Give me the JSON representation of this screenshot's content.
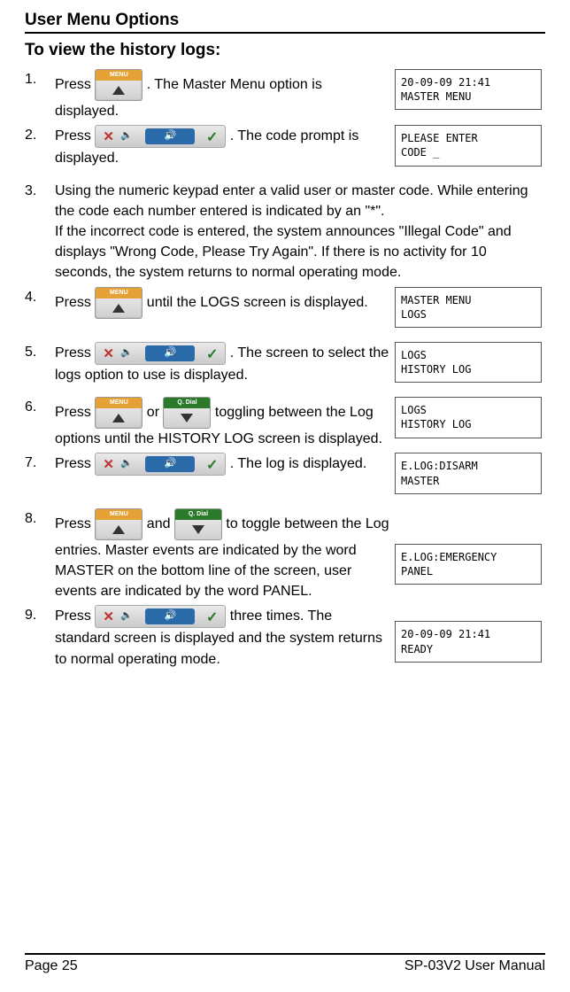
{
  "header": "User Menu Options",
  "subhead": "To view the history logs:",
  "buttons": {
    "menu_label": "MENU",
    "qdial_label": "Q. Dial"
  },
  "steps": [
    {
      "num": "1.",
      "pre": "Press ",
      "post": ". The Master Menu option is displayed."
    },
    {
      "num": "2.",
      "pre": "Press ",
      "post": ". The code prompt is displayed."
    },
    {
      "num": "3.",
      "text": "Using the numeric keypad enter a valid user or master code. While entering the code each number entered is indicated by an \"*\".\nIf the incorrect code is entered, the system announces \"Illegal Code\" and displays \"Wrong Code, Please Try Again\". If there is no activity for 10 seconds, the system returns to normal operating mode."
    },
    {
      "num": "4.",
      "pre": "Press ",
      "post": " until the LOGS screen is displayed."
    },
    {
      "num": "5.",
      "pre": "Press ",
      "post": ". The screen to select the logs option to use is displayed."
    },
    {
      "num": "6.",
      "pre": "Press ",
      "mid": " or ",
      "post": " toggling between the Log options until the HISTORY LOG screen is displayed."
    },
    {
      "num": "7.",
      "pre": "Press ",
      "post": ". The log is displayed."
    },
    {
      "num": "8.",
      "pre": "Press ",
      "mid": " and ",
      "post": " to toggle between the Log entries. Master events are indicated by the word MASTER on the bottom line of the screen, user events are indicated by the word PANEL."
    },
    {
      "num": "9.",
      "pre": "Press ",
      "post": " three times. The standard screen is displayed and the system returns to normal operating mode."
    }
  ],
  "lcds": {
    "l1": "20-09-09 21:41\nMASTER MENU",
    "l2": "PLEASE ENTER\nCODE            _",
    "l4": "MASTER MENU\nLOGS",
    "l5": "LOGS\nHISTORY LOG",
    "l6": "LOGS\nHISTORY LOG",
    "l7": "E.LOG:DISARM\nMASTER",
    "l8": "E.LOG:EMERGENCY\nPANEL",
    "l9": "20-09-09  21:41\nREADY"
  },
  "footer": {
    "page": "Page 25",
    "manual": "SP-03V2 User Manual"
  }
}
